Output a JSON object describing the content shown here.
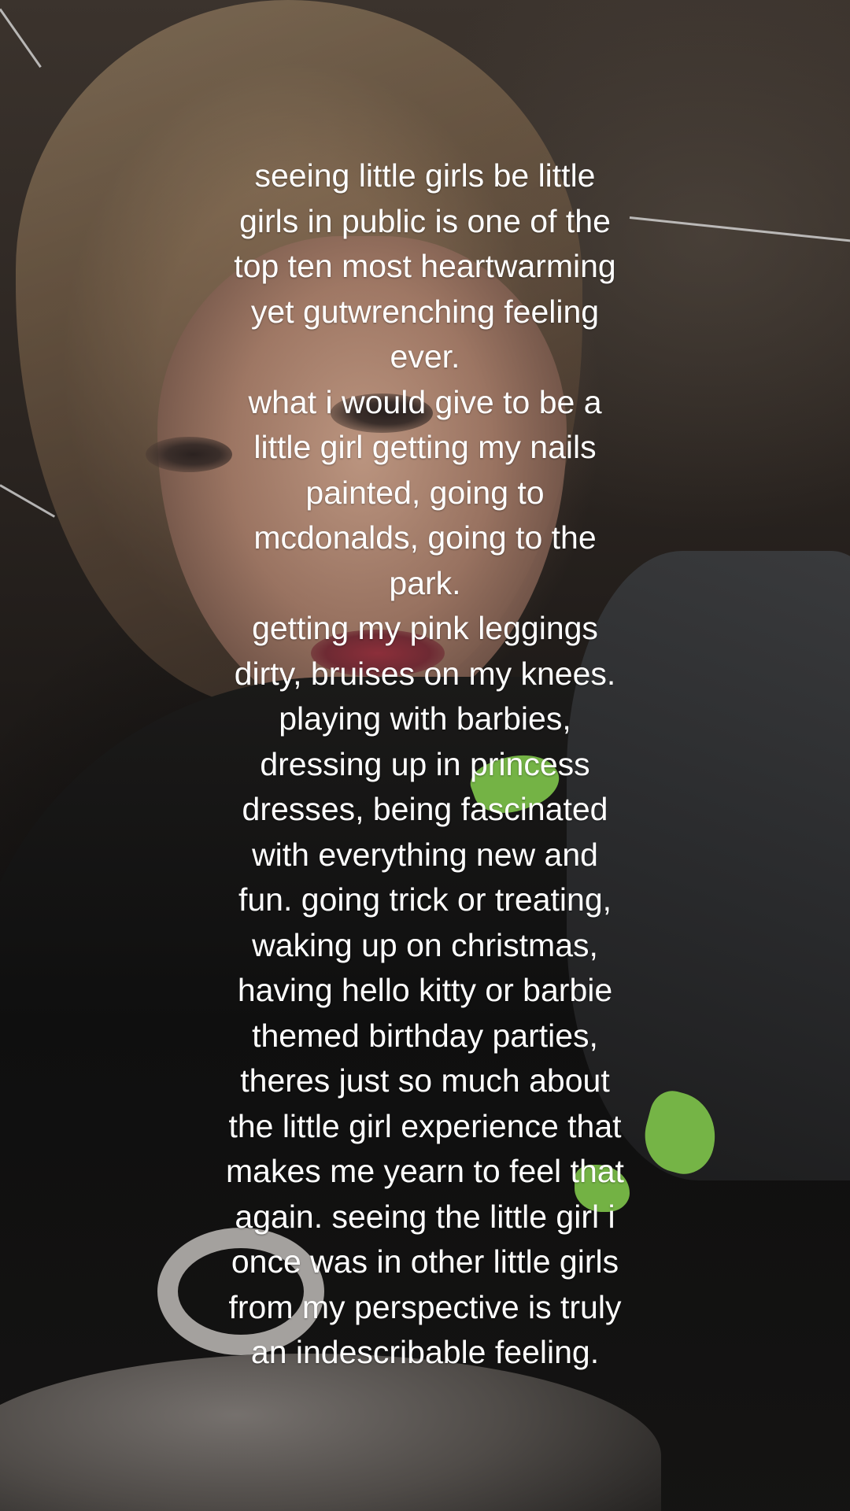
{
  "caption": {
    "lines": [
      "seeing little girls be little",
      "girls in public is one of the",
      "top ten most heartwarming",
      "yet gutwrenching feeling",
      "ever.",
      "what i would give to be a",
      "little girl getting my nails",
      "painted, going to",
      "mcdonalds, going to the",
      "park.",
      "getting my pink leggings",
      "dirty, bruises on my knees.",
      "playing with barbies,",
      "dressing up in princess",
      "dresses, being fascinated",
      "with everything new and",
      "fun. going trick or treating,",
      "waking up on christmas,",
      "having hello kitty or barbie",
      "themed birthday parties,",
      "theres just so much about",
      "the little girl experience that",
      "makes me yearn to feel that",
      "again. seeing the little girl i",
      "once was in other little girls",
      "from my perspective is truly",
      "an indescribable feeling."
    ]
  },
  "colors": {
    "text": "#ffffff",
    "accent_green": "#7ec44a",
    "lip": "#8c2f3a"
  }
}
